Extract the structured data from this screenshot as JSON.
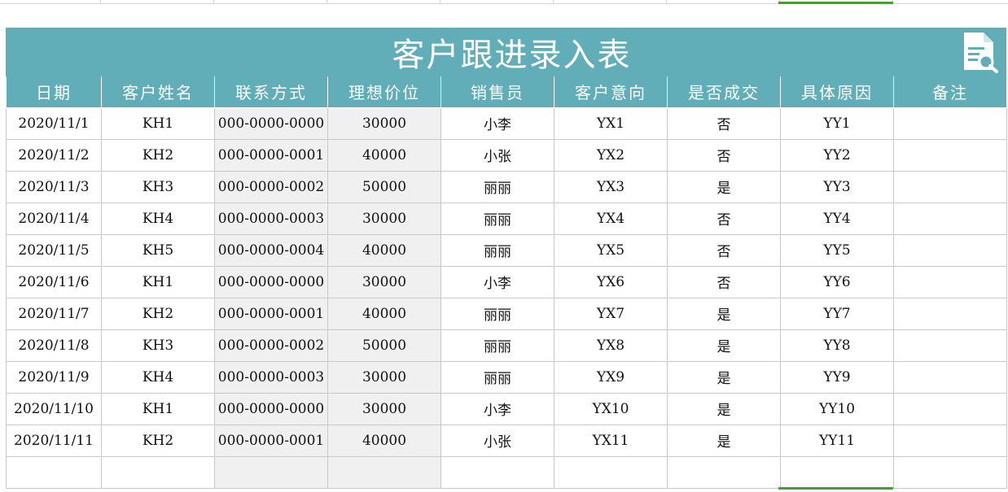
{
  "title": "客户跟进录入表",
  "columns": [
    "日期",
    "客户姓名",
    "联系方式",
    "理想价位",
    "销售员",
    "客户意向",
    "是否成交",
    "具体原因",
    "备注"
  ],
  "rows": [
    [
      "2020/11/1",
      "KH1",
      "000-0000-0000",
      "30000",
      "小李",
      "YX1",
      "否",
      "YY1",
      ""
    ],
    [
      "2020/11/2",
      "KH2",
      "000-0000-0001",
      "40000",
      "小张",
      "YX2",
      "否",
      "YY2",
      ""
    ],
    [
      "2020/11/3",
      "KH3",
      "000-0000-0002",
      "50000",
      "丽丽",
      "YX3",
      "是",
      "YY3",
      ""
    ],
    [
      "2020/11/4",
      "KH4",
      "000-0000-0003",
      "30000",
      "丽丽",
      "YX4",
      "否",
      "YY4",
      ""
    ],
    [
      "2020/11/5",
      "KH5",
      "000-0000-0004",
      "40000",
      "丽丽",
      "YX5",
      "否",
      "YY5",
      ""
    ],
    [
      "2020/11/6",
      "KH1",
      "000-0000-0000",
      "30000",
      "小李",
      "YX6",
      "否",
      "YY6",
      ""
    ],
    [
      "2020/11/7",
      "KH2",
      "000-0000-0001",
      "40000",
      "丽丽",
      "YX7",
      "是",
      "YY7",
      ""
    ],
    [
      "2020/11/8",
      "KH3",
      "000-0000-0002",
      "50000",
      "丽丽",
      "YX8",
      "是",
      "YY8",
      ""
    ],
    [
      "2020/11/9",
      "KH4",
      "000-0000-0003",
      "30000",
      "丽丽",
      "YX9",
      "是",
      "YY9",
      ""
    ],
    [
      "2020/11/10",
      "KH1",
      "000-0000-0000",
      "30000",
      "小李",
      "YX10",
      "是",
      "YY10",
      ""
    ],
    [
      "2020/11/11",
      "KH2",
      "000-0000-0001",
      "40000",
      "小张",
      "YX11",
      "是",
      "YY11",
      ""
    ],
    [
      "",
      "",
      "",
      "",
      "",
      "",
      "",
      "",
      ""
    ]
  ],
  "colors": {
    "header_bg": "#62aeb8",
    "header_text": "#ffffff",
    "shaded_column_bg": "#f0f0f0",
    "selection": "#4a9a3a"
  },
  "icons": {
    "title_icon": "document-search-icon"
  }
}
